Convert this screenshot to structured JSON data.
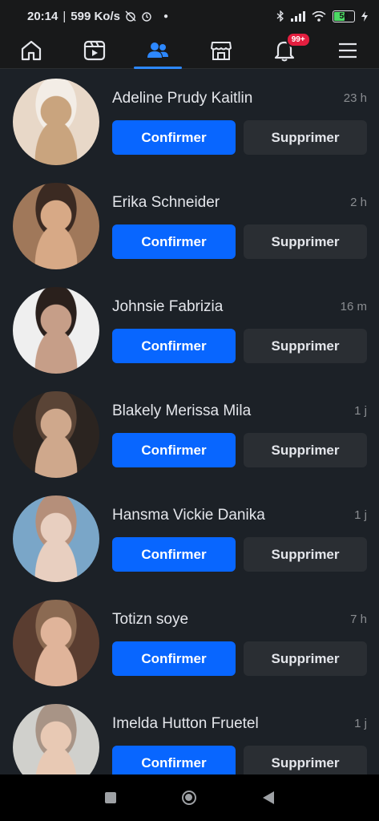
{
  "status": {
    "time": "20:14",
    "speed": "599 Ko/s",
    "battery": "50",
    "icons": [
      "alarm-off-icon",
      "alarm-icon",
      "dot-icon",
      "bluetooth-icon",
      "signal-icon",
      "wifi-icon",
      "battery-icon",
      "charging-icon"
    ]
  },
  "nav": {
    "tabs": [
      {
        "icon": "home-icon"
      },
      {
        "icon": "video-icon"
      },
      {
        "icon": "friends-icon",
        "active": true
      },
      {
        "icon": "marketplace-icon"
      },
      {
        "icon": "notifications-icon",
        "badge": "99+"
      },
      {
        "icon": "menu-icon"
      }
    ],
    "accent": "#2d88ff"
  },
  "requests": [
    {
      "name": "Adeline Prudy Kaitlin",
      "time": "23 h",
      "avatar_colors": [
        "#e8d8c8",
        "#c9a47e",
        "#f3ede6"
      ]
    },
    {
      "name": "Erika Schneider",
      "time": "2 h",
      "avatar_colors": [
        "#a0785a",
        "#d7a986",
        "#3b2a22"
      ]
    },
    {
      "name": "Johnsie Fabrizia",
      "time": "16 m",
      "avatar_colors": [
        "#efefef",
        "#c69e88",
        "#2a201c"
      ]
    },
    {
      "name": "Blakely Merissa Mila",
      "time": "1 j",
      "avatar_colors": [
        "#2b2420",
        "#cfa88c",
        "#5a4436"
      ]
    },
    {
      "name": "Hansma Vickie Danika",
      "time": "1 j",
      "avatar_colors": [
        "#7aa6c8",
        "#e8cfc0",
        "#b58f7a"
      ]
    },
    {
      "name": "Totizn soye",
      "time": "7 h",
      "avatar_colors": [
        "#5a3d30",
        "#e0b49a",
        "#8b6a52"
      ]
    },
    {
      "name": "Imelda Hutton Fruetel",
      "time": "1 j",
      "avatar_colors": [
        "#d0d0cc",
        "#e8c9b4",
        "#a89486"
      ]
    }
  ],
  "labels": {
    "confirm": "Confirmer",
    "delete": "Supprimer"
  },
  "colors": {
    "confirm_button": "#0866ff",
    "delete_button": "#2a2e33",
    "background": "#1c2127"
  }
}
